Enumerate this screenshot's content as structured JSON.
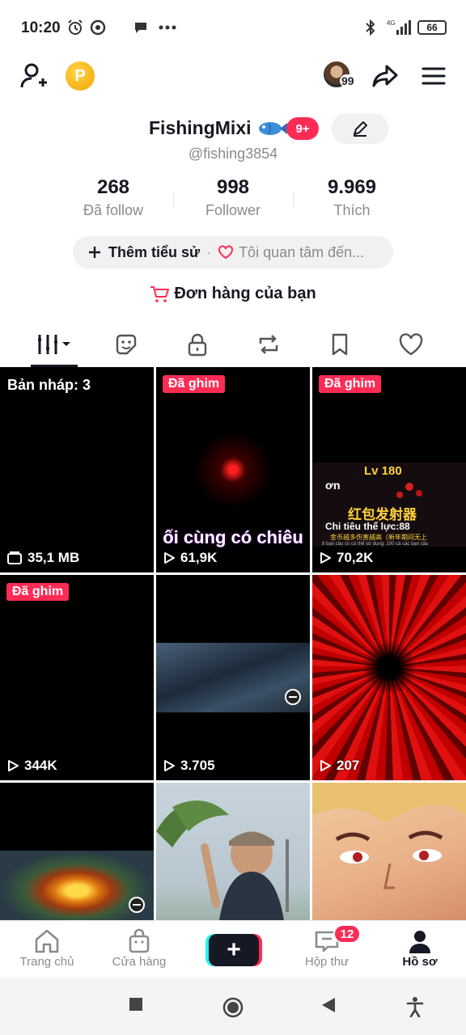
{
  "status_bar": {
    "time": "10:20",
    "network_label": "4G",
    "battery": "66",
    "icons": [
      "alarm-icon",
      "at-icon",
      "chat-icon",
      "more-dots-icon",
      "bluetooth-icon",
      "signal-icon",
      "battery-icon"
    ]
  },
  "top_nav": {
    "coin_label": "P",
    "avatar_badge": "99",
    "icons": [
      "add-user-icon",
      "coin-icon",
      "share-icon",
      "menu-icon"
    ]
  },
  "profile": {
    "name": "FishingMixi",
    "notif_count": "9+",
    "handle": "@fishing3854",
    "stats": [
      {
        "value": "268",
        "label": "Đã follow"
      },
      {
        "value": "998",
        "label": "Follower"
      },
      {
        "value": "9.969",
        "label": "Thích"
      }
    ],
    "bio_add": "Thêm tiểu sử",
    "bio_separator": "·",
    "bio_interest": "Tôi quan tâm đến...",
    "orders": "Đơn hàng của bạn"
  },
  "tabs": [
    "videos-grid-icon",
    "favorites-sticker-icon",
    "private-lock-icon",
    "repost-icon",
    "saved-bookmark-icon",
    "liked-heart-icon"
  ],
  "grid": {
    "draft_label": "Bản nháp: 3",
    "draft_size": "35,1 MB",
    "pinned_label": "Đã ghim",
    "items": [
      {
        "views": "61,9K",
        "overlay": "ối cùng có chiêu"
      },
      {
        "views": "70,2K",
        "game_level": "Lv 180",
        "game_name": "ơn",
        "game_title": "红包发射器",
        "game_stat": "Chi tiêu thể lực:88",
        "game_line1": "金币越多伤害越高（新年期间无上",
        "game_line2": "8 bạn cầu có có thể sử dụng: 100 cá các bạn cầu"
      },
      {
        "views": "344K"
      },
      {
        "views": "3.705"
      },
      {
        "views": "207"
      }
    ]
  },
  "bottom_nav": {
    "items": [
      "Trang chủ",
      "Cửa hàng",
      "Hộp thư",
      "Hồ sơ"
    ],
    "plus": "+",
    "inbox_badge": "12"
  },
  "colors": {
    "accent": "#fe2c55",
    "cyan": "#25f4ee",
    "text": "#161823",
    "muted": "#8a8b91"
  }
}
